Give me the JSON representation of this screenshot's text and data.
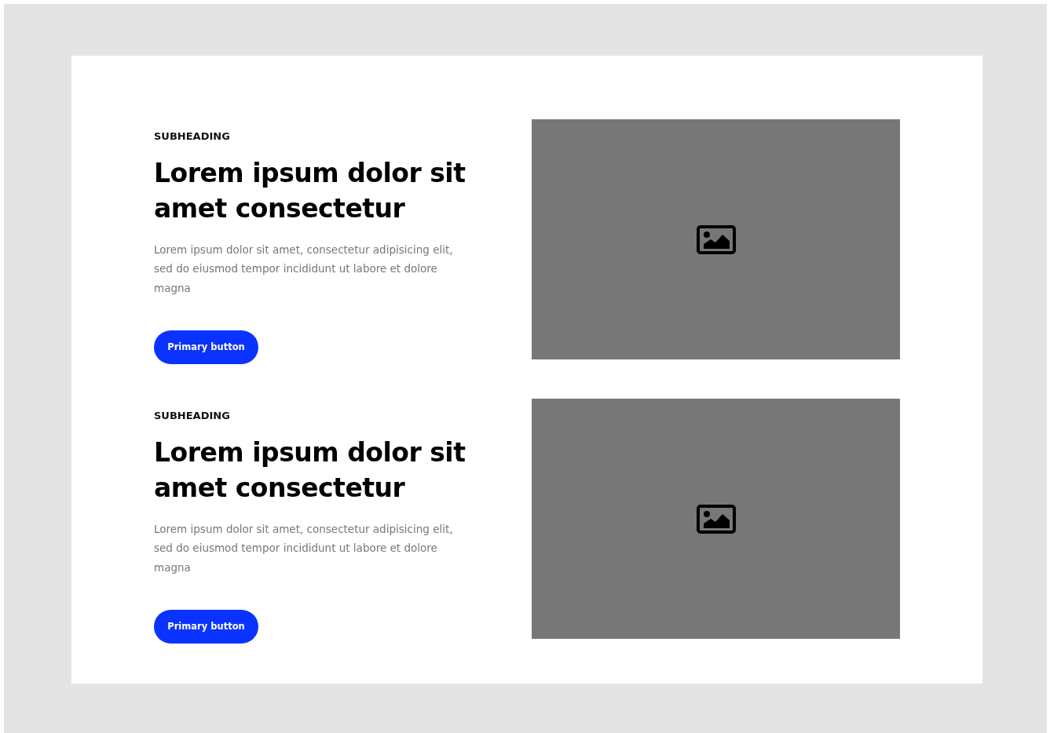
{
  "sections": [
    {
      "subheading": "SUBHEADING",
      "heading": "Lorem ipsum dolor sit amet consectetur",
      "body": "Lorem ipsum dolor sit amet, consectetur adipisicing elit, sed do eiusmod tempor incididunt ut labore et dolore magna",
      "button": "Primary button"
    },
    {
      "subheading": "SUBHEADING",
      "heading": "Lorem ipsum dolor sit amet consectetur",
      "body": "Lorem ipsum dolor sit amet, consectetur adipisicing elit, sed do eiusmod tempor incididunt ut labore et dolore magna",
      "button": "Primary button"
    }
  ]
}
